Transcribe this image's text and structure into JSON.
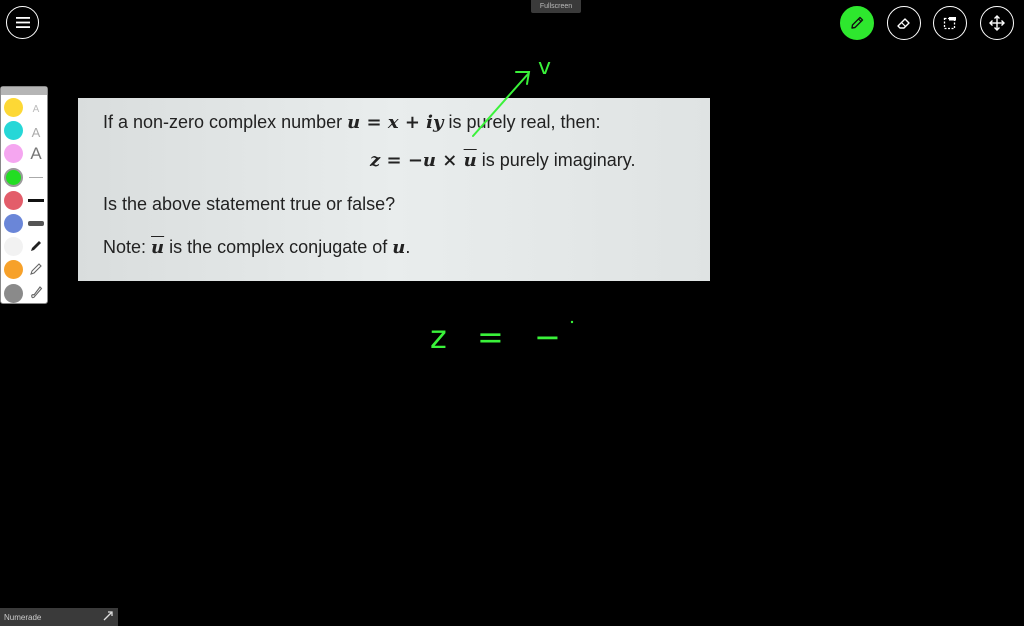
{
  "top_bar": {
    "fullscreen_label": "Fullscreen"
  },
  "toolbar": {
    "tools": [
      {
        "name": "pen-tool",
        "active": true
      },
      {
        "name": "eraser-tool",
        "active": false
      },
      {
        "name": "selection-tool",
        "active": false
      },
      {
        "name": "move-tool",
        "active": false
      }
    ]
  },
  "palette": {
    "colors": [
      "#fdd835",
      "#26d7d7",
      "#f5a6f0",
      "#22dd22",
      "#e35d6a",
      "#6a86d8",
      "#f2f2f2",
      "#f7a12a",
      "#8a8a8a"
    ],
    "selected_color": "#22dd22",
    "text_size_label": "A"
  },
  "question": {
    "line1_pre": "If a non-zero complex number ",
    "line1_math": "u = x + iy",
    "line1_post": " is purely real, then:",
    "line2_math_a": "z = −u × ",
    "line2_math_ubar": "u",
    "line2_post": " is purely imaginary.",
    "line3": "Is the above statement true or false?",
    "line4_pre": "Note: ",
    "line4_ubar": "u",
    "line4_mid": " is the complex conjugate of ",
    "line4_u": "u",
    "line4_end": "."
  },
  "handwriting": {
    "annotation_v": "v",
    "work_line": "z = −"
  },
  "footer": {
    "brand": "Numerade"
  }
}
